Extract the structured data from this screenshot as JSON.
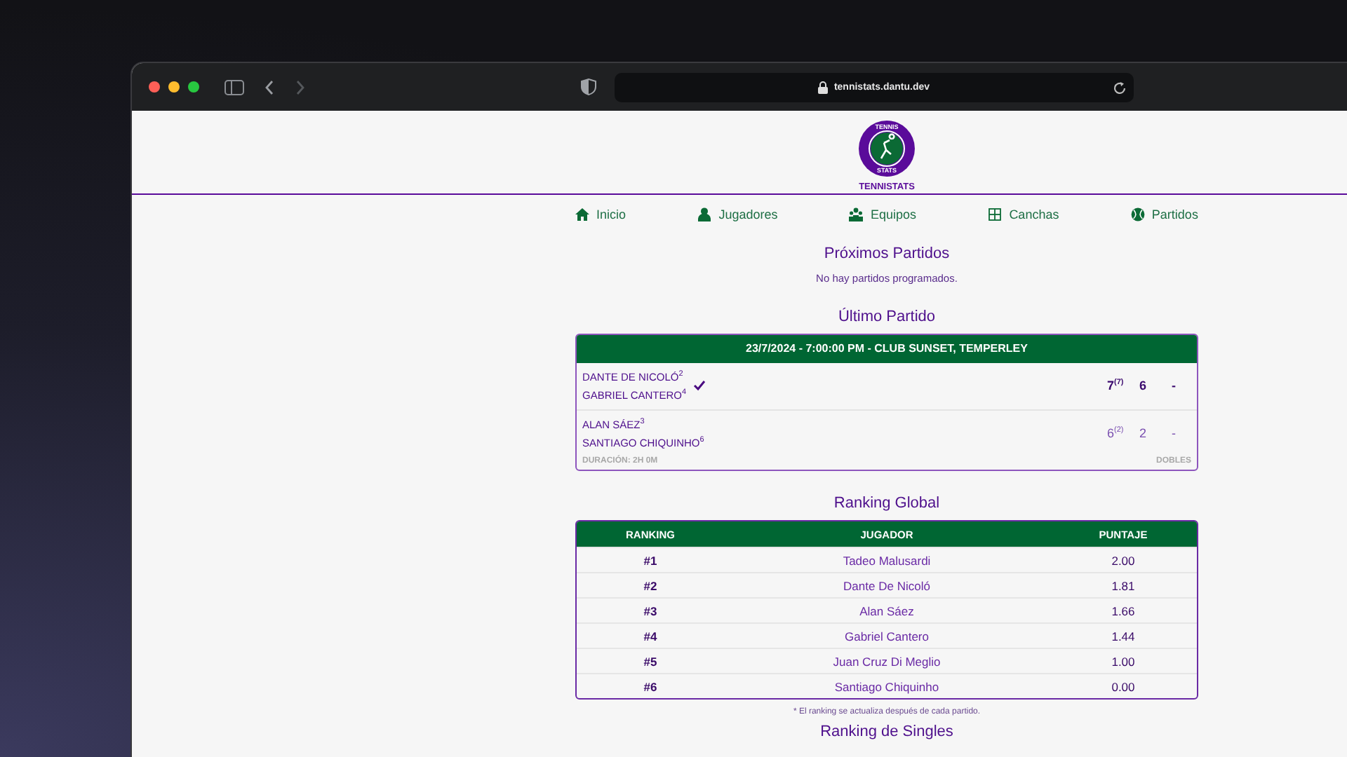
{
  "browser": {
    "url": "tennistats.dantu.dev"
  },
  "logo": {
    "top_text": "TENNIS",
    "bottom_text": "STATS",
    "name": "TENNISTATS"
  },
  "nav": [
    {
      "label": "Inicio",
      "kind": "home"
    },
    {
      "label": "Jugadores",
      "kind": "player"
    },
    {
      "label": "Equipos",
      "kind": "team"
    },
    {
      "label": "Canchas",
      "kind": "court"
    },
    {
      "label": "Partidos",
      "kind": "ball"
    }
  ],
  "upcoming": {
    "title": "Próximos Partidos",
    "message": "No hay partidos programados."
  },
  "last_match": {
    "title": "Último Partido",
    "header": "23/7/2024 - 7:00:00 PM - CLUB SUNSET, TEMPERLEY",
    "teams": [
      {
        "winner": true,
        "players": [
          {
            "name": "DANTE DE NICOLÓ",
            "seed": "2"
          },
          {
            "name": "GABRIEL CANTERO",
            "seed": "4"
          }
        ],
        "sets": [
          {
            "games": "7",
            "tiebreak": "(7)"
          },
          {
            "games": "6"
          },
          {
            "games": "-"
          }
        ]
      },
      {
        "winner": false,
        "players": [
          {
            "name": "ALAN SÁEZ",
            "seed": "3"
          },
          {
            "name": "SANTIAGO CHIQUINHO",
            "seed": "6"
          }
        ],
        "sets": [
          {
            "games": "6",
            "tiebreak": "(2)"
          },
          {
            "games": "2"
          },
          {
            "games": "-"
          }
        ]
      }
    ],
    "duration": "DURACIÓN: 2H 0M",
    "type": "DOBLES"
  },
  "ranking": {
    "title": "Ranking Global",
    "columns": [
      "RANKING",
      "JUGADOR",
      "PUNTAJE"
    ],
    "rows": [
      [
        "#1",
        "Tadeo Malusardi",
        "2.00"
      ],
      [
        "#2",
        "Dante De Nicoló",
        "1.81"
      ],
      [
        "#3",
        "Alan Sáez",
        "1.66"
      ],
      [
        "#4",
        "Gabriel Cantero",
        "1.44"
      ],
      [
        "#5",
        "Juan Cruz Di Meglio",
        "1.00"
      ],
      [
        "#6",
        "Santiago Chiquinho",
        "0.00"
      ]
    ],
    "note": "* El ranking se actualiza después de cada partido."
  },
  "next_section": {
    "title": "Ranking de Singles"
  }
}
